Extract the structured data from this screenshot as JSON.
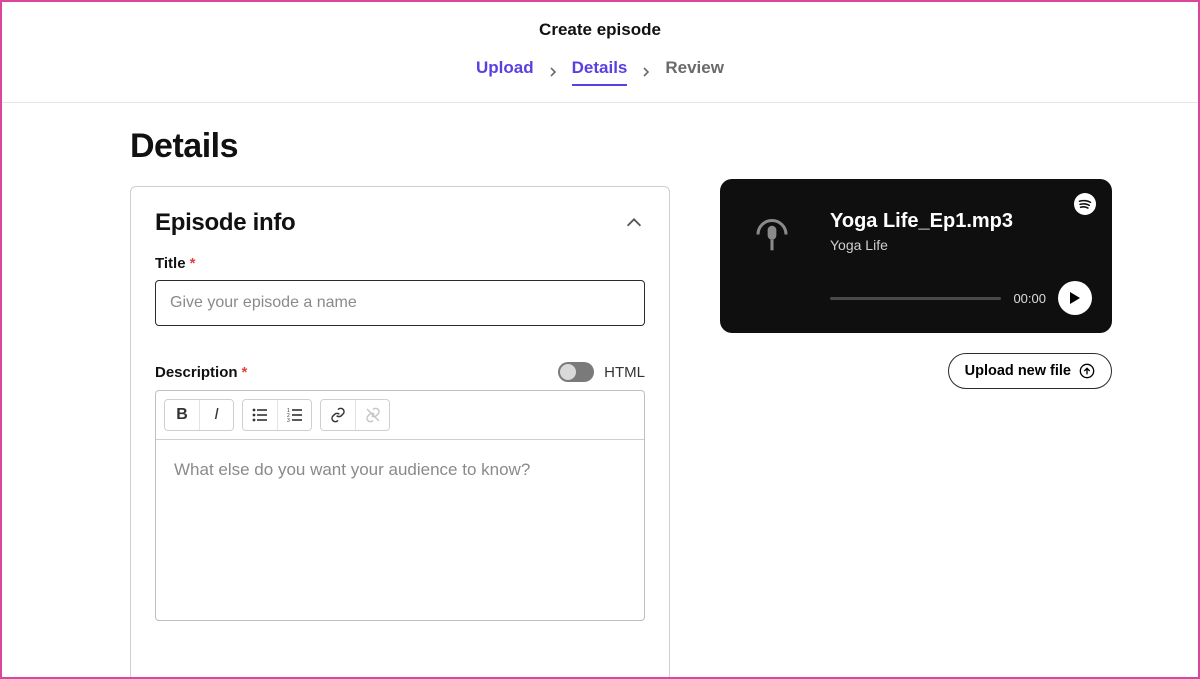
{
  "header": {
    "title": "Create episode",
    "steps": [
      "Upload",
      "Details",
      "Review"
    ],
    "active_step_index": 1
  },
  "main": {
    "heading": "Details",
    "card": {
      "title": "Episode info",
      "title_field": {
        "label": "Title",
        "placeholder": "Give your episode a name"
      },
      "description_field": {
        "label": "Description",
        "html_toggle_label": "HTML",
        "placeholder": "What else do you want your audience to know?"
      }
    }
  },
  "player": {
    "file_name": "Yoga Life_Ep1.mp3",
    "show_name": "Yoga Life",
    "time": "00:00"
  },
  "actions": {
    "upload_new_label": "Upload new file"
  }
}
